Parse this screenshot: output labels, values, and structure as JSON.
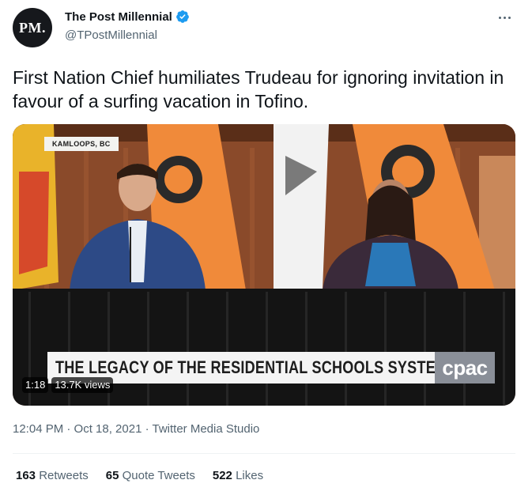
{
  "author": {
    "avatar_text": "PM.",
    "name": "The Post Millennial",
    "handle": "@TPostMillennial",
    "verified_color": "#1d9bf0"
  },
  "tweet": {
    "text": "First Nation Chief humiliates Trudeau for ignoring invitation in favour of a surfing vacation in Tofino."
  },
  "media": {
    "location_tag": "KAMLOOPS, BC",
    "caption": "THE LEGACY OF THE RESIDENTIAL SCHOOLS SYSTEM",
    "broadcaster_logo": "cpac",
    "duration": "1:18",
    "views": "13.7K views"
  },
  "meta": {
    "time_date_source": "12:04 PM · Oct 18, 2021 · Twitter Media Studio"
  },
  "stats": {
    "retweets_count": "163",
    "retweets_label": "Retweets",
    "quotes_count": "65",
    "quotes_label": "Quote Tweets",
    "likes_count": "522",
    "likes_label": "Likes"
  },
  "icons": {
    "verified": "verified-badge-icon",
    "more": "more-options-icon"
  }
}
